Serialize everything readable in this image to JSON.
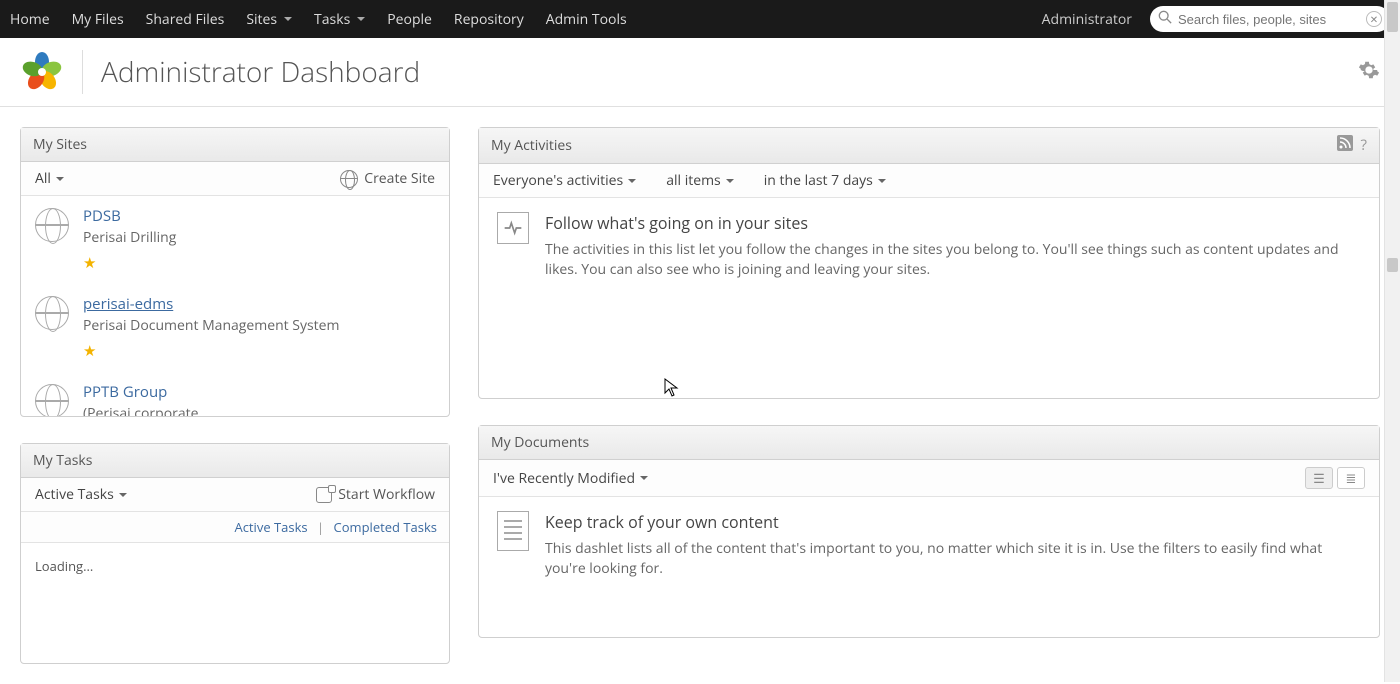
{
  "topnav": {
    "items": [
      {
        "label": "Home",
        "dropdown": false
      },
      {
        "label": "My Files",
        "dropdown": false
      },
      {
        "label": "Shared Files",
        "dropdown": false
      },
      {
        "label": "Sites",
        "dropdown": true
      },
      {
        "label": "Tasks",
        "dropdown": true
      },
      {
        "label": "People",
        "dropdown": false
      },
      {
        "label": "Repository",
        "dropdown": false
      },
      {
        "label": "Admin Tools",
        "dropdown": false
      }
    ],
    "user": "Administrator",
    "search_placeholder": "Search files, people, sites"
  },
  "header": {
    "title": "Administrator Dashboard"
  },
  "my_sites": {
    "title": "My Sites",
    "filter": "All",
    "create_label": "Create Site",
    "items": [
      {
        "name": "PDSB",
        "desc": "Perisai Drilling"
      },
      {
        "name": "perisai-edms",
        "desc": "Perisai Document Management System"
      },
      {
        "name": "PPTB Group",
        "desc": "(Perisai corporate"
      }
    ]
  },
  "my_tasks": {
    "title": "My Tasks",
    "filter": "Active Tasks",
    "start_label": "Start Workflow",
    "link_active": "Active Tasks",
    "link_completed": "Completed Tasks",
    "loading": "Loading..."
  },
  "my_activities": {
    "title": "My Activities",
    "filter_who": "Everyone's activities",
    "filter_items": "all items",
    "filter_range": "in the last 7 days",
    "empty_title": "Follow what's going on in your sites",
    "empty_desc": "The activities in this list let you follow the changes in the sites you belong to. You'll see things such as content updates and likes. You can also see who is joining and leaving your sites."
  },
  "my_documents": {
    "title": "My Documents",
    "filter": "I've Recently Modified",
    "empty_title": "Keep track of your own content",
    "empty_desc": "This dashlet lists all of the content that's important to you, no matter which site it is in. Use the filters to easily find what you're looking for."
  }
}
